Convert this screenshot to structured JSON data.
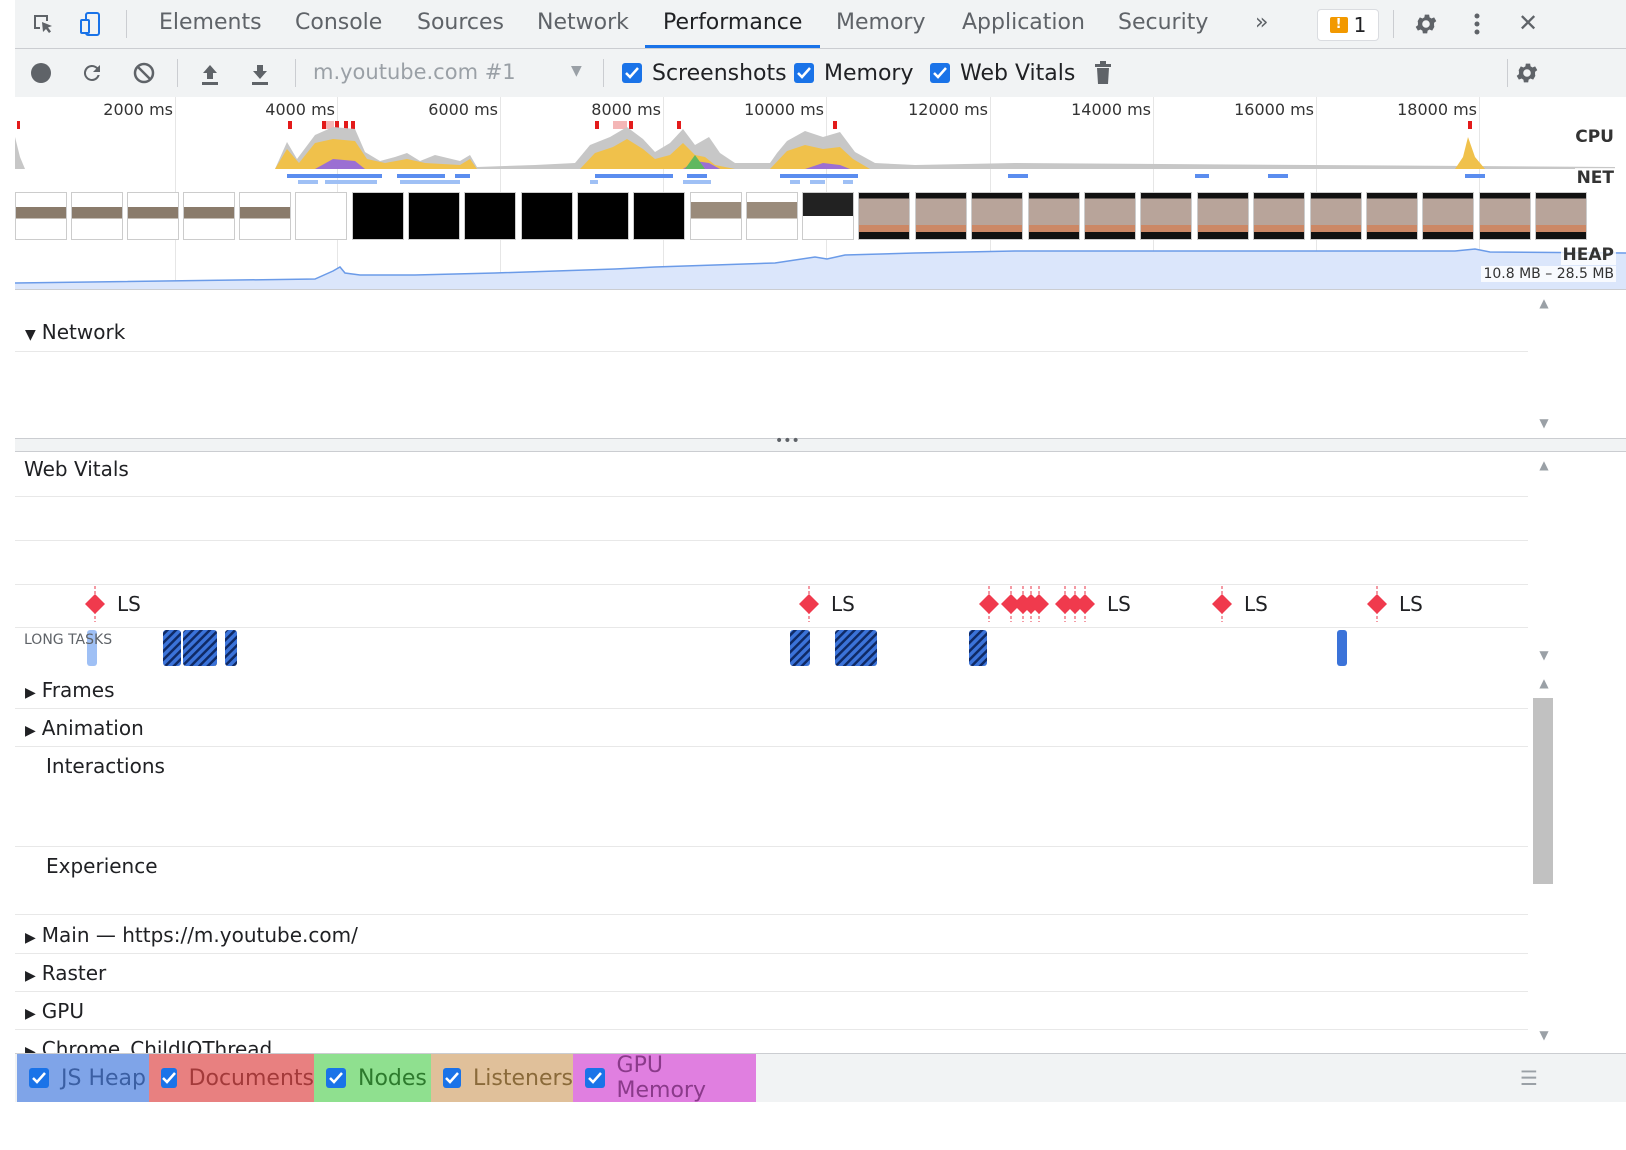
{
  "tabs": {
    "items": [
      {
        "label": "Elements"
      },
      {
        "label": "Console"
      },
      {
        "label": "Sources"
      },
      {
        "label": "Network"
      },
      {
        "label": "Performance",
        "active": true
      },
      {
        "label": "Memory"
      },
      {
        "label": "Application"
      },
      {
        "label": "Security"
      }
    ],
    "more_label": "»",
    "issues_count": "1",
    "close_label": "✕"
  },
  "toolbar": {
    "profile_select": "m.youtube.com #1",
    "checkboxes": [
      {
        "label": "Screenshots",
        "checked": true
      },
      {
        "label": "Memory",
        "checked": true
      },
      {
        "label": "Web Vitals",
        "checked": true
      }
    ]
  },
  "overview": {
    "ticks": [
      "2000 ms",
      "4000 ms",
      "6000 ms",
      "8000 ms",
      "10000 ms",
      "12000 ms",
      "14000 ms",
      "16000 ms",
      "18000 ms"
    ],
    "cpu_label": "CPU",
    "net_label": "NET",
    "heap_label": "HEAP",
    "heap_range": "10.8 MB – 28.5 MB"
  },
  "network_section": {
    "title": "Network"
  },
  "web_vitals": {
    "title": "Web Vitals",
    "ls_label": "LS",
    "long_tasks_label": "LONG TASKS"
  },
  "tracks": {
    "frames": "Frames",
    "animation": "Animation",
    "interactions": "Interactions",
    "experience": "Experience",
    "main": "Main — https://m.youtube.com/",
    "raster": "Raster",
    "gpu": "GPU",
    "child_io": "Chrome_ChildIOThread"
  },
  "counters": [
    {
      "label": "JS Heap",
      "color": "#7fa4e8"
    },
    {
      "label": "Documents",
      "color": "#e88080"
    },
    {
      "label": "Nodes",
      "color": "#8fe08f"
    },
    {
      "label": "Listeners",
      "color": "#e0c09a"
    },
    {
      "label": "GPU Memory",
      "color": "#e07fe0"
    }
  ],
  "icons": [
    "inspect-element-icon",
    "device-toolbar-icon",
    "issues-icon",
    "settings-gear-icon",
    "kebab-menu-icon",
    "close-icon",
    "record-icon",
    "reload-icon",
    "clear-icon",
    "upload-icon",
    "download-icon",
    "dropdown-caret-icon",
    "trash-icon",
    "capture-settings-icon",
    "disclosure-triangle-icon",
    "lcp-diamond-icon",
    "drag-handle-icon",
    "hamburger-icon"
  ]
}
